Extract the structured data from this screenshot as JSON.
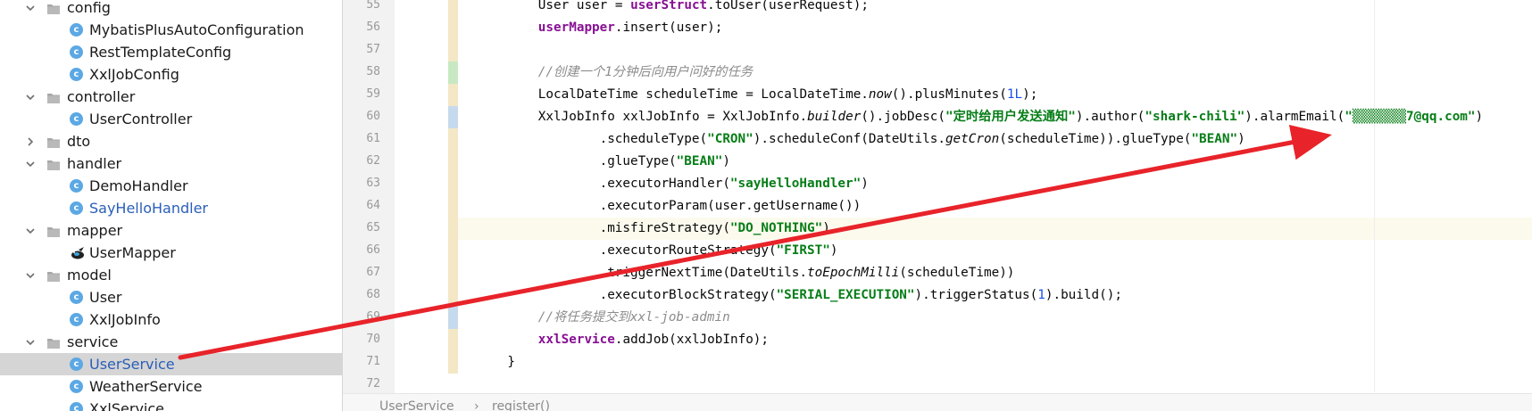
{
  "project_tree": {
    "items": [
      {
        "label": "config",
        "type": "folder",
        "expanded": true,
        "depth": 1
      },
      {
        "label": "MybatisPlusAutoConfiguration",
        "type": "class",
        "depth": 2
      },
      {
        "label": "RestTemplateConfig",
        "type": "class",
        "depth": 2
      },
      {
        "label": "XxlJobConfig",
        "type": "class",
        "depth": 2
      },
      {
        "label": "controller",
        "type": "folder",
        "expanded": true,
        "depth": 1
      },
      {
        "label": "UserController",
        "type": "class",
        "depth": 2
      },
      {
        "label": "dto",
        "type": "folder",
        "expanded": false,
        "depth": 1
      },
      {
        "label": "handler",
        "type": "folder",
        "expanded": true,
        "depth": 1
      },
      {
        "label": "DemoHandler",
        "type": "class",
        "depth": 2
      },
      {
        "label": "SayHelloHandler",
        "type": "class",
        "depth": 2,
        "modified": true
      },
      {
        "label": "mapper",
        "type": "folder",
        "expanded": true,
        "depth": 1
      },
      {
        "label": "UserMapper",
        "type": "mybatis",
        "depth": 2
      },
      {
        "label": "model",
        "type": "folder",
        "expanded": true,
        "depth": 1
      },
      {
        "label": "User",
        "type": "class",
        "depth": 2
      },
      {
        "label": "XxlJobInfo",
        "type": "class",
        "depth": 2
      },
      {
        "label": "service",
        "type": "folder",
        "expanded": true,
        "depth": 1
      },
      {
        "label": "UserService",
        "type": "class",
        "depth": 2,
        "selected": true,
        "modified": true
      },
      {
        "label": "WeatherService",
        "type": "class",
        "depth": 2
      },
      {
        "label": "XxlService",
        "type": "class",
        "depth": 2
      }
    ]
  },
  "editor": {
    "lines": [
      {
        "num": "55",
        "indent": 8,
        "tokens": [
          [
            "t",
            "User user = "
          ],
          [
            "fld",
            "userStruct"
          ],
          [
            "t",
            ".toUser(userRequest);"
          ]
        ]
      },
      {
        "num": "56",
        "indent": 8,
        "tokens": [
          [
            "fld",
            "userMapper"
          ],
          [
            "t",
            ".insert(user);"
          ]
        ]
      },
      {
        "num": "57",
        "indent": 0,
        "tokens": []
      },
      {
        "num": "58",
        "indent": 8,
        "tokens": [
          [
            "cmt",
            "//创建一个1分钟后向用户问好的任务"
          ]
        ]
      },
      {
        "num": "59",
        "indent": 8,
        "tokens": [
          [
            "t",
            "LocalDateTime scheduleTime = LocalDateTime."
          ],
          [
            "it",
            "now"
          ],
          [
            "t",
            "().plusMinutes("
          ],
          [
            "num",
            "1L"
          ],
          [
            "t",
            ");"
          ]
        ]
      },
      {
        "num": "60",
        "indent": 8,
        "tokens": [
          [
            "t",
            "XxlJobInfo xxlJobInfo = XxlJobInfo."
          ],
          [
            "it",
            "builder"
          ],
          [
            "t",
            "().jobDesc("
          ],
          [
            "str",
            "\"定时给用户发送通知\""
          ],
          [
            "t",
            ").author("
          ],
          [
            "str",
            "\"shark-chili\""
          ],
          [
            "t",
            ").alarmEmail("
          ],
          [
            "str",
            "\"▒▒▒▒▒▒▒7@qq.com\""
          ],
          [
            "t",
            ")"
          ]
        ]
      },
      {
        "num": "61",
        "indent": 16,
        "tokens": [
          [
            "t",
            ".scheduleType("
          ],
          [
            "str",
            "\"CRON\""
          ],
          [
            "t",
            ").scheduleConf(DateUtils."
          ],
          [
            "it",
            "getCron"
          ],
          [
            "t",
            "(scheduleTime)).glueType("
          ],
          [
            "str",
            "\"BEAN\""
          ],
          [
            "t",
            ")"
          ]
        ]
      },
      {
        "num": "62",
        "indent": 16,
        "tokens": [
          [
            "t",
            ".glueType("
          ],
          [
            "str",
            "\"BEAN\""
          ],
          [
            "t",
            ")"
          ]
        ]
      },
      {
        "num": "63",
        "indent": 16,
        "tokens": [
          [
            "t",
            ".executorHandler("
          ],
          [
            "str",
            "\"sayHelloHandler\""
          ],
          [
            "t",
            ")"
          ]
        ]
      },
      {
        "num": "64",
        "indent": 16,
        "tokens": [
          [
            "t",
            ".executorParam(user.getUsername())"
          ]
        ]
      },
      {
        "num": "65",
        "indent": 16,
        "tokens": [
          [
            "t",
            ".misfireStrategy("
          ],
          [
            "str",
            "\"DO_NOTHING\""
          ],
          [
            "t",
            ")"
          ]
        ]
      },
      {
        "num": "66",
        "indent": 16,
        "tokens": [
          [
            "t",
            ".executorRouteStrategy("
          ],
          [
            "str",
            "\"FIRST\""
          ],
          [
            "t",
            ")"
          ]
        ]
      },
      {
        "num": "67",
        "indent": 16,
        "tokens": [
          [
            "t",
            ".triggerNextTime(DateUtils."
          ],
          [
            "it",
            "toEpochMilli"
          ],
          [
            "t",
            "(scheduleTime))"
          ]
        ]
      },
      {
        "num": "68",
        "indent": 16,
        "tokens": [
          [
            "t",
            ".executorBlockStrategy("
          ],
          [
            "str",
            "\"SERIAL_EXECUTION\""
          ],
          [
            "t",
            ").triggerStatus("
          ],
          [
            "num",
            "1"
          ],
          [
            "t",
            ").build();"
          ]
        ]
      },
      {
        "num": "69",
        "indent": 8,
        "tokens": [
          [
            "cmt",
            "//将任务提交到xxl-job-admin"
          ]
        ]
      },
      {
        "num": "70",
        "indent": 8,
        "tokens": [
          [
            "fld",
            "xxlService"
          ],
          [
            "t",
            ".addJob(xxlJobInfo);"
          ]
        ]
      },
      {
        "num": "71",
        "indent": 4,
        "tokens": [
          [
            "t",
            "}"
          ]
        ]
      },
      {
        "num": "72",
        "indent": 0,
        "tokens": []
      }
    ],
    "current_line": "65"
  },
  "breadcrumb": {
    "class": "UserService",
    "separator": "›",
    "method": "register()"
  },
  "colors": {
    "annotation_arrow": "#e8232a",
    "class_icon": "#5ba8e4",
    "selection": "#d5d5d5"
  }
}
